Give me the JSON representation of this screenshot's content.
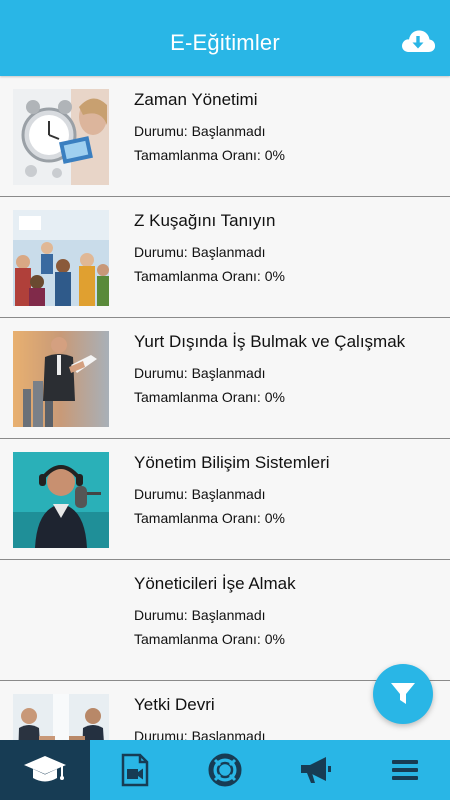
{
  "header": {
    "title": "E-Eğitimler",
    "action_icon": "cloud-download-icon"
  },
  "colors": {
    "primary": "#29b6e6",
    "active_tab": "#173c54",
    "card_bg": "#f7f7f7",
    "divider": "#8a8a8a"
  },
  "courses": [
    {
      "title": "Zaman Yönetimi",
      "status": "Durumu: Başlanmadı",
      "completion": "Tamamlanma Oranı: 0%"
    },
    {
      "title": "Z Kuşağını Tanıyın",
      "status": "Durumu: Başlanmadı",
      "completion": "Tamamlanma Oranı: 0%"
    },
    {
      "title": "Yurt Dışında İş Bulmak ve Çalışmak",
      "status": "Durumu: Başlanmadı",
      "completion": "Tamamlanma Oranı: 0%"
    },
    {
      "title": "Yönetim Bilişim Sistemleri",
      "status": "Durumu: Başlanmadı",
      "completion": "Tamamlanma Oranı: 0%"
    },
    {
      "title": "Yöneticileri İşe Almak",
      "status": "Durumu: Başlanmadı",
      "completion": "Tamamlanma Oranı: 0%"
    },
    {
      "title": "Yetki Devri",
      "status": "Durumu: Başlanmadı",
      "completion": ""
    }
  ],
  "filter_button": {
    "icon": "filter-icon"
  },
  "tabbar": {
    "active_index": 0,
    "items": [
      {
        "icon": "graduation-cap-icon"
      },
      {
        "icon": "video-file-icon"
      },
      {
        "icon": "life-ring-icon"
      },
      {
        "icon": "megaphone-icon"
      },
      {
        "icon": "menu-icon"
      }
    ]
  }
}
